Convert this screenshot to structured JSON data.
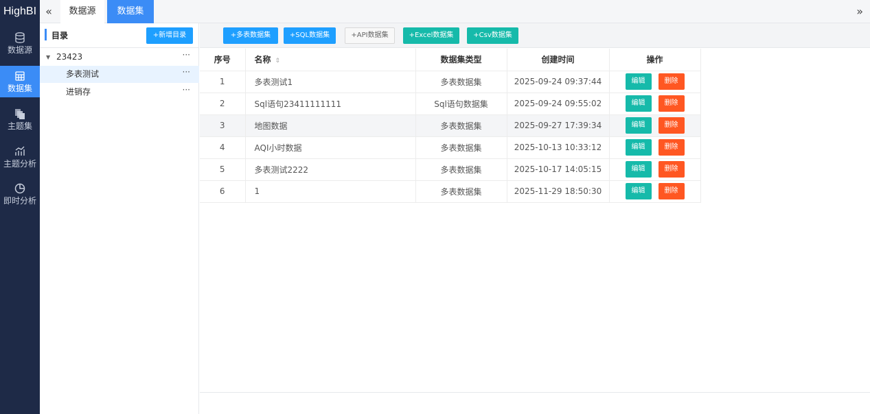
{
  "app": {
    "logo": "HighBI",
    "collapse_icon": "«",
    "expand_icon": "»"
  },
  "tabs": [
    {
      "label": "数据源",
      "active": false
    },
    {
      "label": "数据集",
      "active": true
    }
  ],
  "sidebar": {
    "items": [
      {
        "label": "数据源",
        "icon": "database-icon",
        "active": false
      },
      {
        "label": "数据集",
        "icon": "table-icon",
        "active": true
      },
      {
        "label": "主题集",
        "icon": "layers-icon",
        "active": false
      },
      {
        "label": "主题分析",
        "icon": "chart-analysis-icon",
        "active": false
      },
      {
        "label": "即时分析",
        "icon": "pie-chart-icon",
        "active": false
      }
    ]
  },
  "tree": {
    "title": "目录",
    "add_button": "+新增目录",
    "nodes": [
      {
        "label": "23423",
        "caret": "▼",
        "more": "···"
      },
      {
        "label": "多表测试",
        "more": "···",
        "selected": true
      },
      {
        "label": "进销存",
        "more": "···"
      }
    ]
  },
  "toolbar": {
    "buttons": [
      {
        "label": "+多表数据集",
        "style": "blue"
      },
      {
        "label": "+SQL数据集",
        "style": "blue"
      },
      {
        "label": "+API数据集",
        "style": "gray"
      },
      {
        "label": "+Excel数据集",
        "style": "green"
      },
      {
        "label": "+Csv数据集",
        "style": "green"
      }
    ]
  },
  "table": {
    "columns": [
      "序号",
      "名称",
      "数据集类型",
      "创建时间",
      "操作"
    ],
    "sort_icon": "⇕",
    "edit_label": "编辑",
    "delete_label": "删除",
    "rows": [
      {
        "index": "1",
        "name": "多表测试1",
        "type": "多表数据集",
        "created": "2025-09-24 09:37:44"
      },
      {
        "index": "2",
        "name": "Sql语句23411111111",
        "type": "Sql语句数据集",
        "created": "2025-09-24 09:55:02"
      },
      {
        "index": "3",
        "name": "地图数据",
        "type": "多表数据集",
        "created": "2025-09-27 17:39:34"
      },
      {
        "index": "4",
        "name": "AQI小时数据",
        "type": "多表数据集",
        "created": "2025-10-13 10:33:12"
      },
      {
        "index": "5",
        "name": "多表测试2222",
        "type": "多表数据集",
        "created": "2025-10-17 14:05:15"
      },
      {
        "index": "6",
        "name": "1",
        "type": "多表数据集",
        "created": "2025-11-29 18:50:30"
      }
    ]
  },
  "colors": {
    "sidebar_bg": "#1e2a47",
    "accent": "#3b8cf6",
    "btn_blue": "#1e9fff",
    "btn_green": "#16baaa",
    "btn_red": "#ff5722"
  }
}
